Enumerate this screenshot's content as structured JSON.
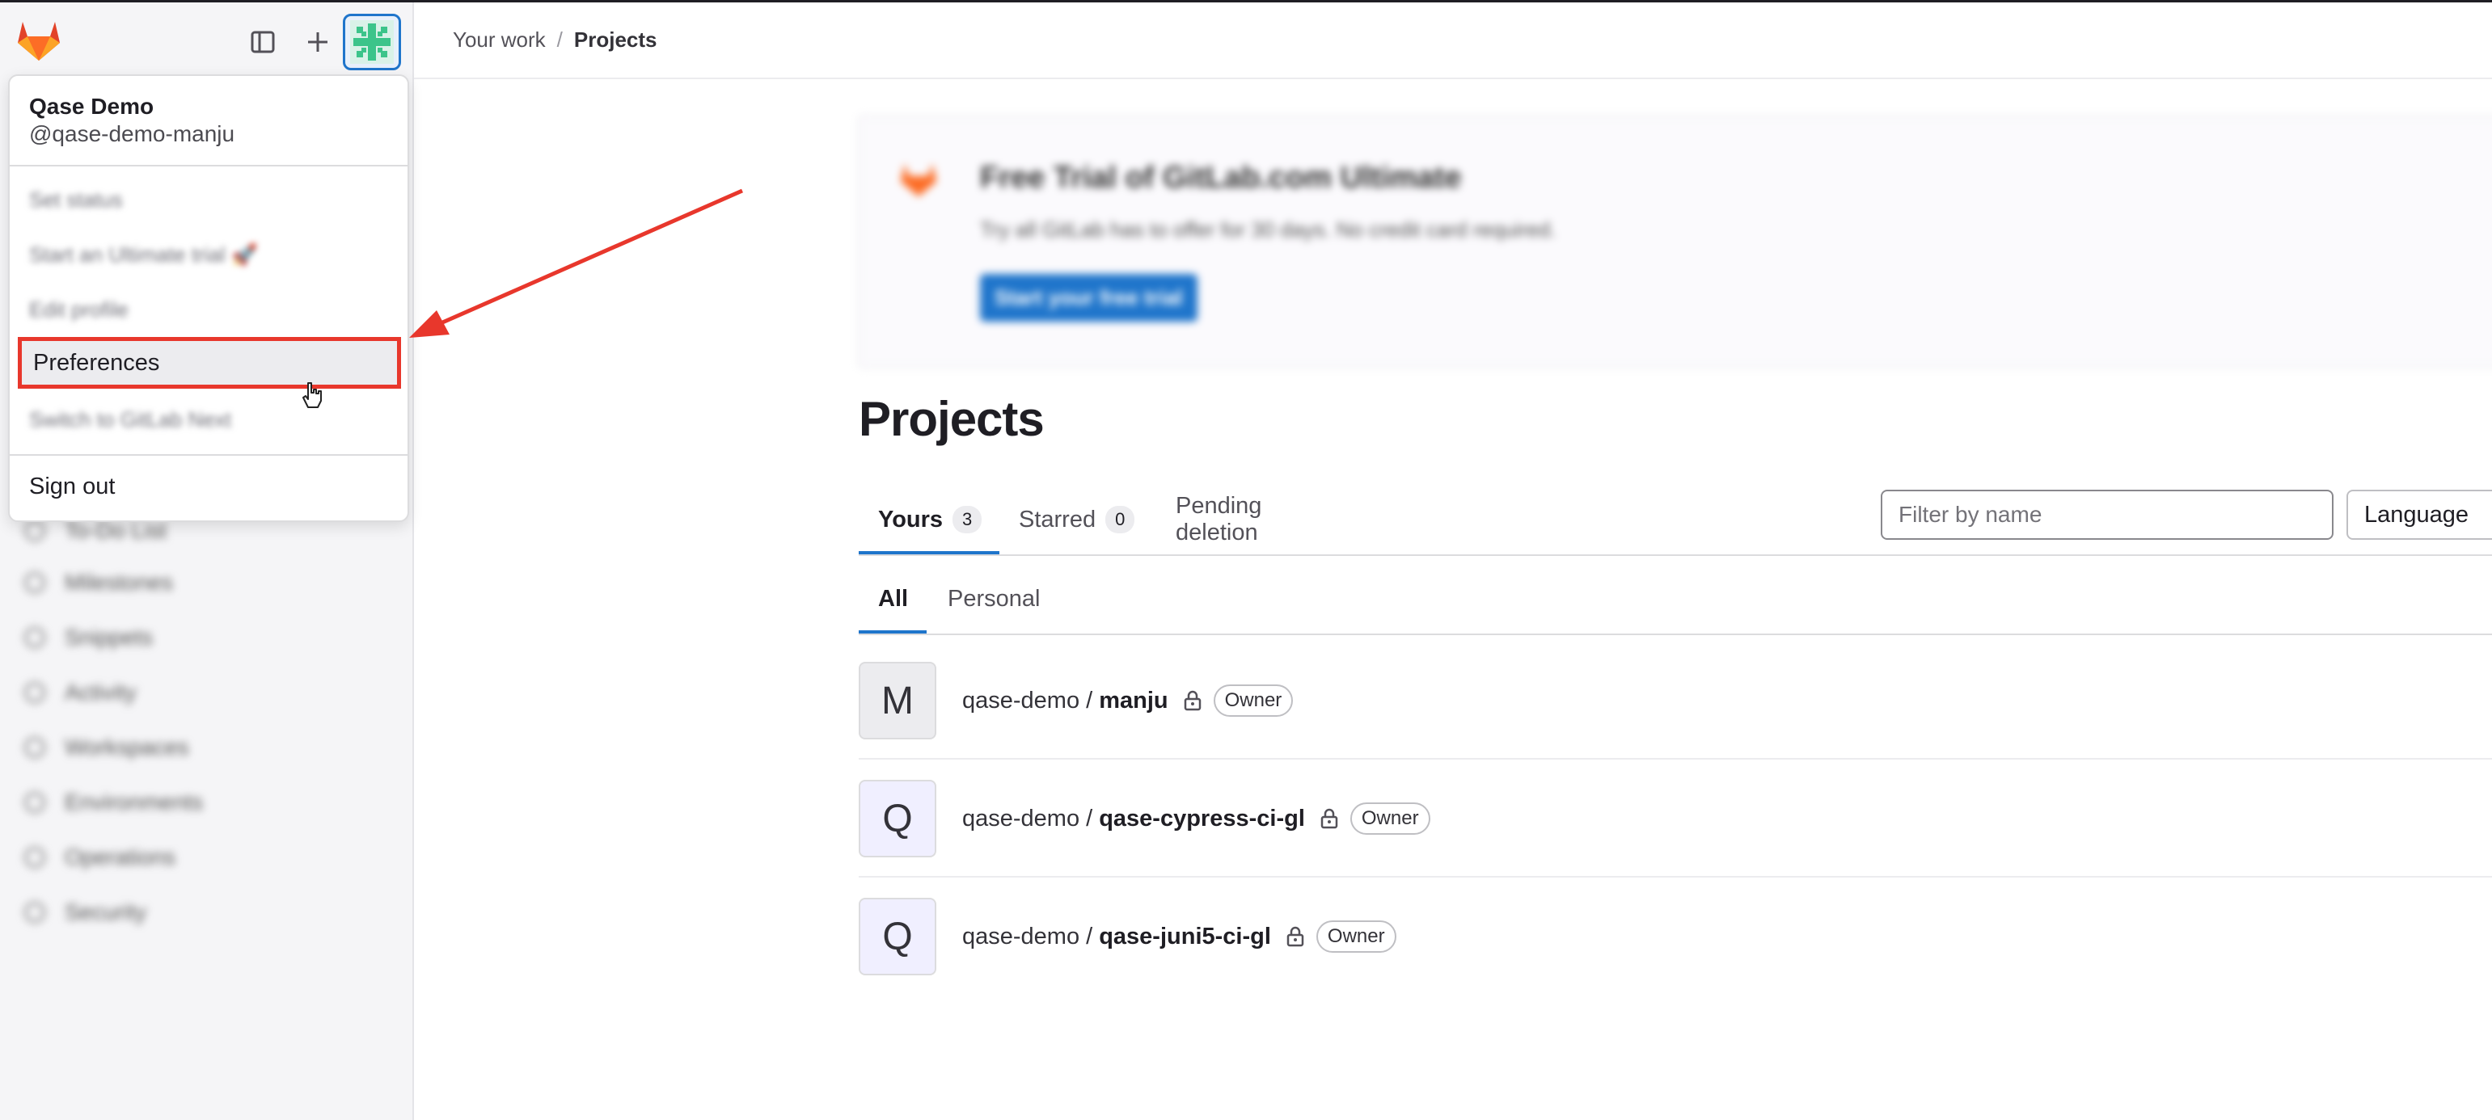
{
  "sidebar": {
    "nav_items": [
      "To-Do List",
      "Milestones",
      "Snippets",
      "Activity",
      "Workspaces",
      "Environments",
      "Operations",
      "Security"
    ]
  },
  "user_menu": {
    "name": "Qase Demo",
    "handle": "@qase-demo-manju",
    "items": [
      "Set status",
      "Start an Ultimate trial 🚀",
      "Edit profile",
      "Preferences",
      "Switch to GitLab Next"
    ],
    "sign_out": "Sign out"
  },
  "breadcrumb": {
    "parent": "Your work",
    "separator": "/",
    "current": "Projects"
  },
  "trial_banner": {
    "title": "Free Trial of GitLab.com Ultimate",
    "subtitle": "Try all GitLab has to offer for 30 days. No credit card required.",
    "button": "Start your free trial"
  },
  "page": {
    "title": "Projects"
  },
  "tabs": [
    {
      "label": "Yours",
      "count": "3"
    },
    {
      "label": "Starred",
      "count": "0"
    },
    {
      "label": "Pending deletion"
    }
  ],
  "filter": {
    "placeholder": "Filter by name",
    "language": "Language"
  },
  "subtabs": [
    "All",
    "Personal"
  ],
  "projects": [
    {
      "avatar": "M",
      "namespace": "qase-demo /",
      "name": "manju",
      "role": "Owner"
    },
    {
      "avatar": "Q",
      "namespace": "qase-demo /",
      "name": "qase-cypress-ci-gl",
      "role": "Owner"
    },
    {
      "avatar": "Q",
      "namespace": "qase-demo /",
      "name": "qase-juni5-ci-gl",
      "role": "Owner"
    }
  ],
  "colors": {
    "accent": "#1f75cb",
    "highlight": "#e8372c",
    "gitlab_orange": "#fc6d26"
  }
}
